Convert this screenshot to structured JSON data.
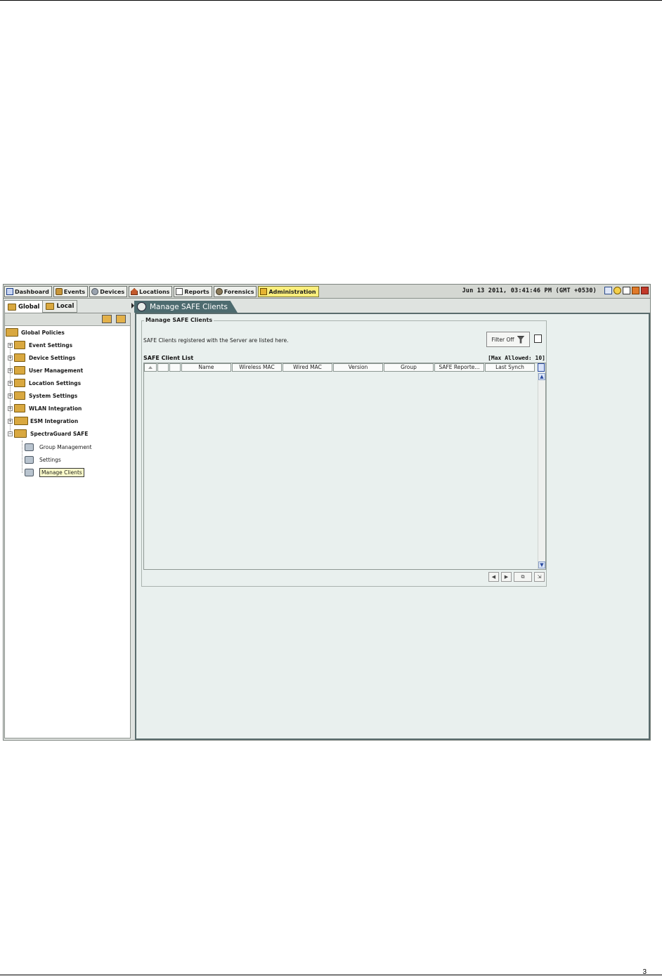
{
  "nav": {
    "tabs": [
      {
        "label": "Dashboard",
        "icon": "dashboard-icon"
      },
      {
        "label": "Events",
        "icon": "events-icon"
      },
      {
        "label": "Devices",
        "icon": "devices-icon"
      },
      {
        "label": "Locations",
        "icon": "locations-icon"
      },
      {
        "label": "Reports",
        "icon": "reports-icon"
      },
      {
        "label": "Forensics",
        "icon": "forensics-icon"
      },
      {
        "label": "Administration",
        "icon": "administration-icon",
        "active": true
      }
    ],
    "datetime": "Jun 13 2011, 03:41:46 PM (GMT +0530)",
    "active_color": "#fbef7c"
  },
  "left_panel": {
    "tabs": {
      "global": "Global",
      "local": "Local"
    },
    "tree": {
      "root": "Global Policies",
      "items": [
        {
          "label": "Event Settings"
        },
        {
          "label": "Device Settings"
        },
        {
          "label": "User Management"
        },
        {
          "label": "Location Settings"
        },
        {
          "label": "System Settings"
        },
        {
          "label": "WLAN Integration"
        },
        {
          "label": "ESM Integration"
        },
        {
          "label": "SpectraGuard SAFE"
        }
      ],
      "children": [
        {
          "label": "Group Management"
        },
        {
          "label": "Settings"
        },
        {
          "label": "Manage Clients",
          "selected": true
        }
      ]
    }
  },
  "main": {
    "tab_title": "Manage SAFE Clients",
    "section_title": "Manage SAFE Clients",
    "description": "SAFE Clients registered with the Server are listed here.",
    "filter_label": "Filter Off",
    "list_title": "SAFE Client List",
    "max_allowed": "[Max Allowed: 10]",
    "columns": [
      "Name",
      "Wireless MAC",
      "Wired MAC",
      "Version",
      "Group",
      "SAFE Reporte...",
      "Last Synch"
    ],
    "rows": []
  },
  "footer": {
    "page_number": "3"
  }
}
